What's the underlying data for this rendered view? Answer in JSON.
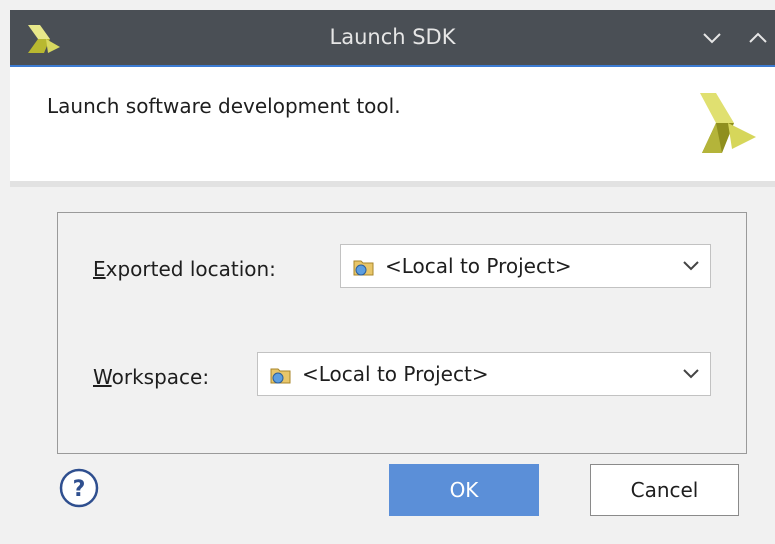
{
  "window": {
    "title": "Launch SDK",
    "icons": {
      "app": "xilinx-logo-icon",
      "minimize": "chevron-down-icon",
      "maximize": "chevron-up-icon"
    },
    "colors": {
      "titlebar": "#4a4f55",
      "accent": "#3c7bd2"
    }
  },
  "header": {
    "description": "Launch software development tool.",
    "logo": "xilinx-logo-icon"
  },
  "form": {
    "exported_location": {
      "label_mnemonic": "E",
      "label_rest": "xported location:",
      "value": "<Local to Project>",
      "icon": "folder-icon"
    },
    "workspace": {
      "label_mnemonic": "W",
      "label_rest": "orkspace:",
      "value": "<Local to Project>",
      "icon": "folder-icon"
    }
  },
  "footer": {
    "help_icon": "help-icon",
    "ok_label": "OK",
    "cancel_label": "Cancel",
    "colors": {
      "ok_button": "#5b8fd8"
    }
  }
}
